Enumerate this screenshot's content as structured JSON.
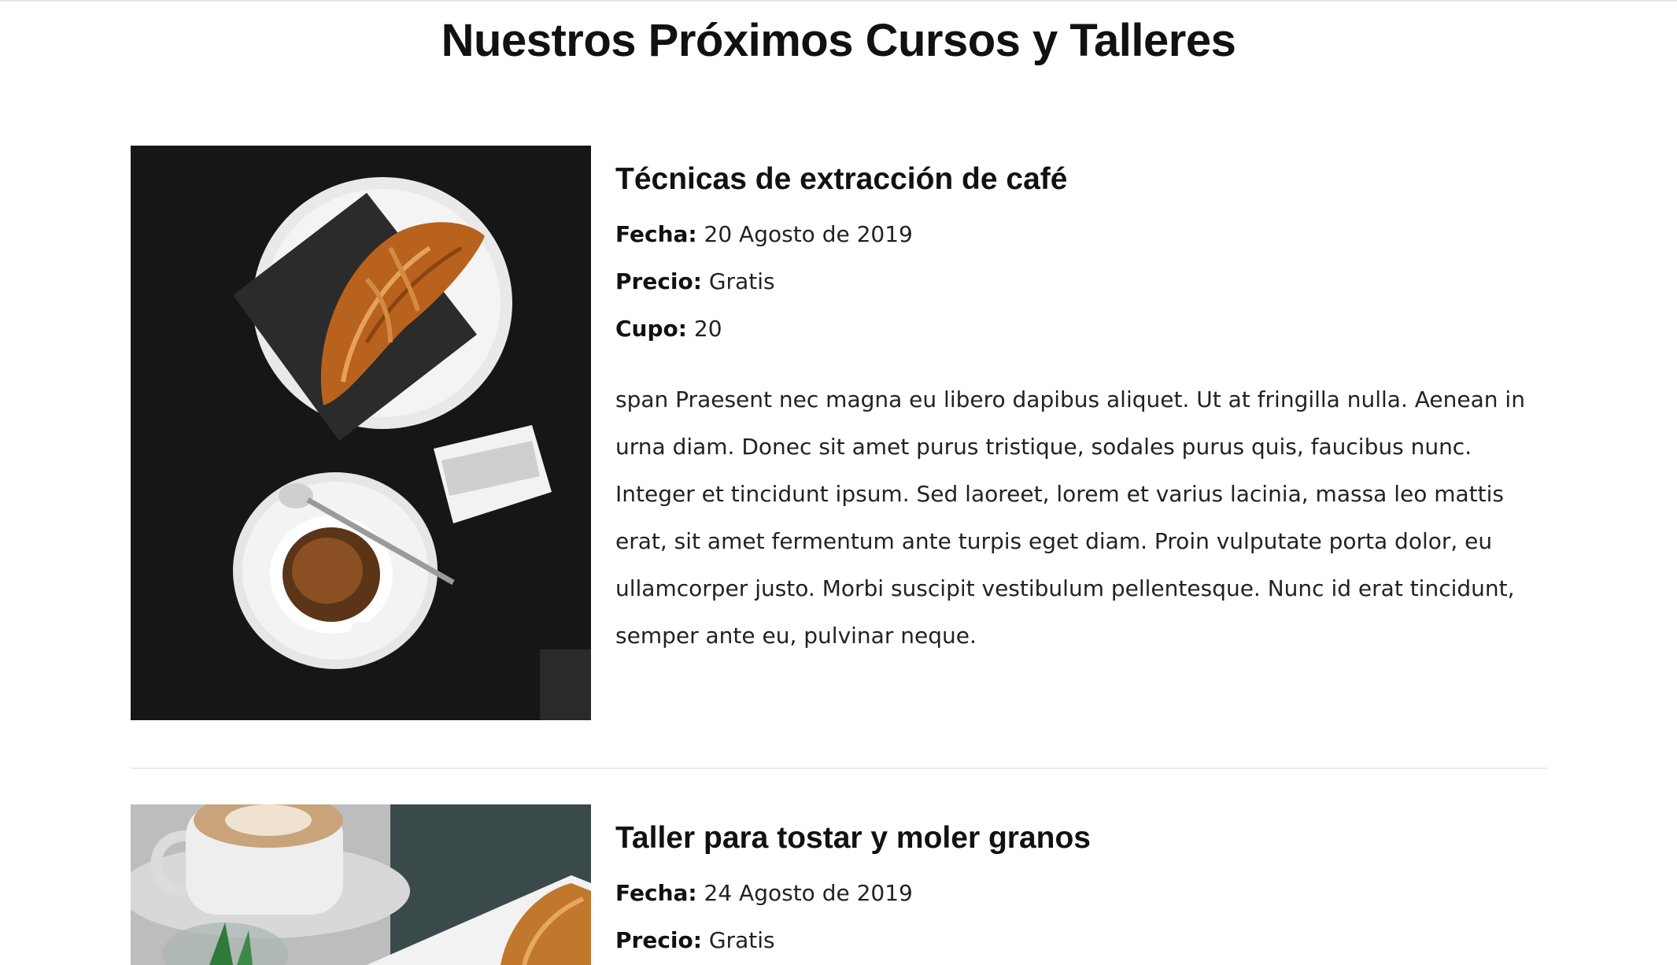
{
  "page": {
    "title": "Nuestros Próximos Cursos y Talleres"
  },
  "courses": [
    {
      "title": "Técnicas de extracción de café",
      "date_label": "Fecha:",
      "date_value": "20 Agosto de 2019",
      "price_label": "Precio:",
      "price_value": "Gratis",
      "capacity_label": "Cupo:",
      "capacity_value": "20",
      "description": "span Praesent nec magna eu libero dapibus aliquet. Ut at fringilla nulla. Aenean in urna diam. Donec sit amet purus tristique, sodales purus quis, faucibus nunc. Integer et tincidunt ipsum. Sed laoreet, lorem et varius lacinia, massa leo mattis erat, sit amet fermentum ante turpis eget diam. Proin vulputate porta dolor, eu ullamcorper justo. Morbi suscipit vestibulum pellentesque. Nunc id erat tincidunt, semper ante eu, pulvinar neque.",
      "image": "croissant-and-espresso-photo"
    },
    {
      "title": "Taller para tostar y moler granos",
      "date_label": "Fecha:",
      "date_value": "24 Agosto de 2019",
      "price_label": "Precio:",
      "price_value": "Gratis",
      "image": "cappuccino-and-pastry-photo"
    }
  ]
}
